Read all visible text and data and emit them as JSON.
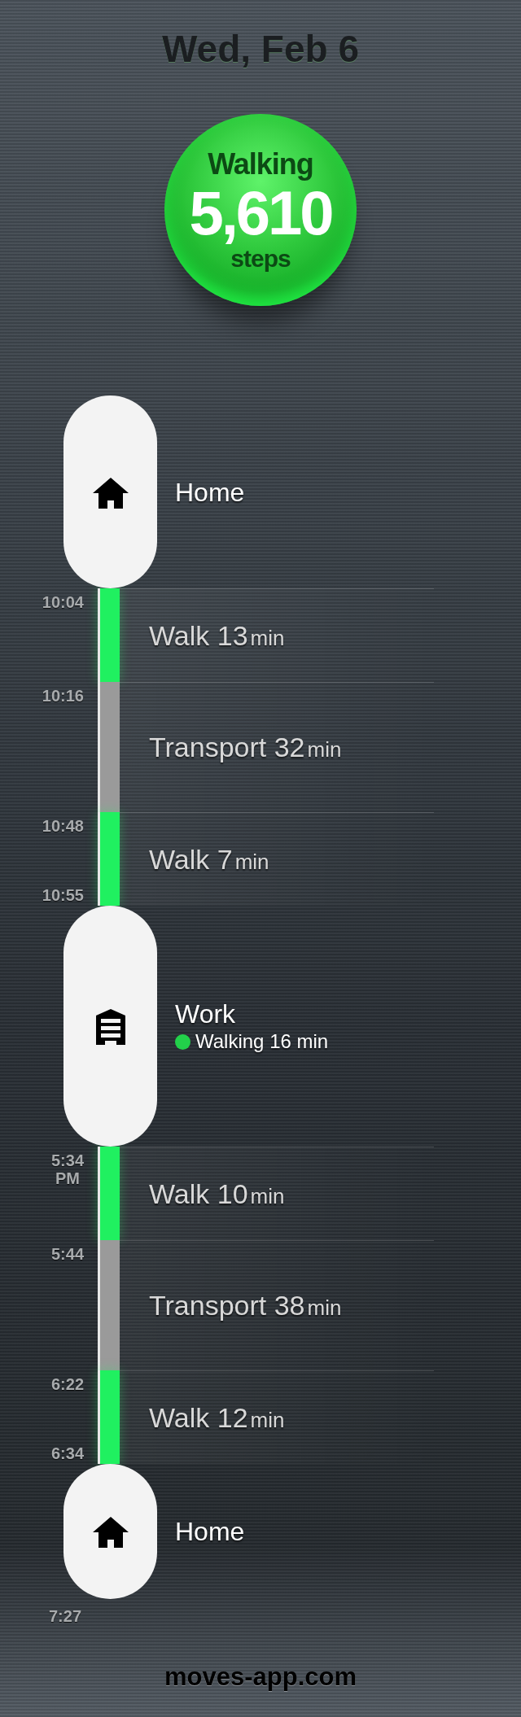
{
  "header": {
    "date": "Wed, Feb 6"
  },
  "summary": {
    "activity": "Walking",
    "count": "5,610",
    "unit": "steps"
  },
  "timeline": [
    {
      "kind": "home",
      "name": "Home"
    },
    {
      "kind": "walk",
      "label": "Walk",
      "duration": "13",
      "unit": "min",
      "time": "10:04"
    },
    {
      "kind": "transport",
      "label": "Transport",
      "duration": "32",
      "unit": "min",
      "time": "10:16"
    },
    {
      "kind": "walk",
      "label": "Walk",
      "duration": "7",
      "unit": "min",
      "time": "10:48",
      "end_time": "10:55"
    },
    {
      "kind": "work",
      "name": "Work",
      "note": "Walking 16 min"
    },
    {
      "kind": "walk",
      "label": "Walk",
      "duration": "10",
      "unit": "min",
      "time": "5:34\nPM"
    },
    {
      "kind": "transport",
      "label": "Transport",
      "duration": "38",
      "unit": "min",
      "time": "5:44"
    },
    {
      "kind": "walk",
      "label": "Walk",
      "duration": "12",
      "unit": "min",
      "time": "6:22",
      "end_time": "6:34"
    },
    {
      "kind": "home",
      "name": "Home",
      "end_time": "7:27"
    }
  ],
  "footer": {
    "site": "moves-app.com"
  }
}
